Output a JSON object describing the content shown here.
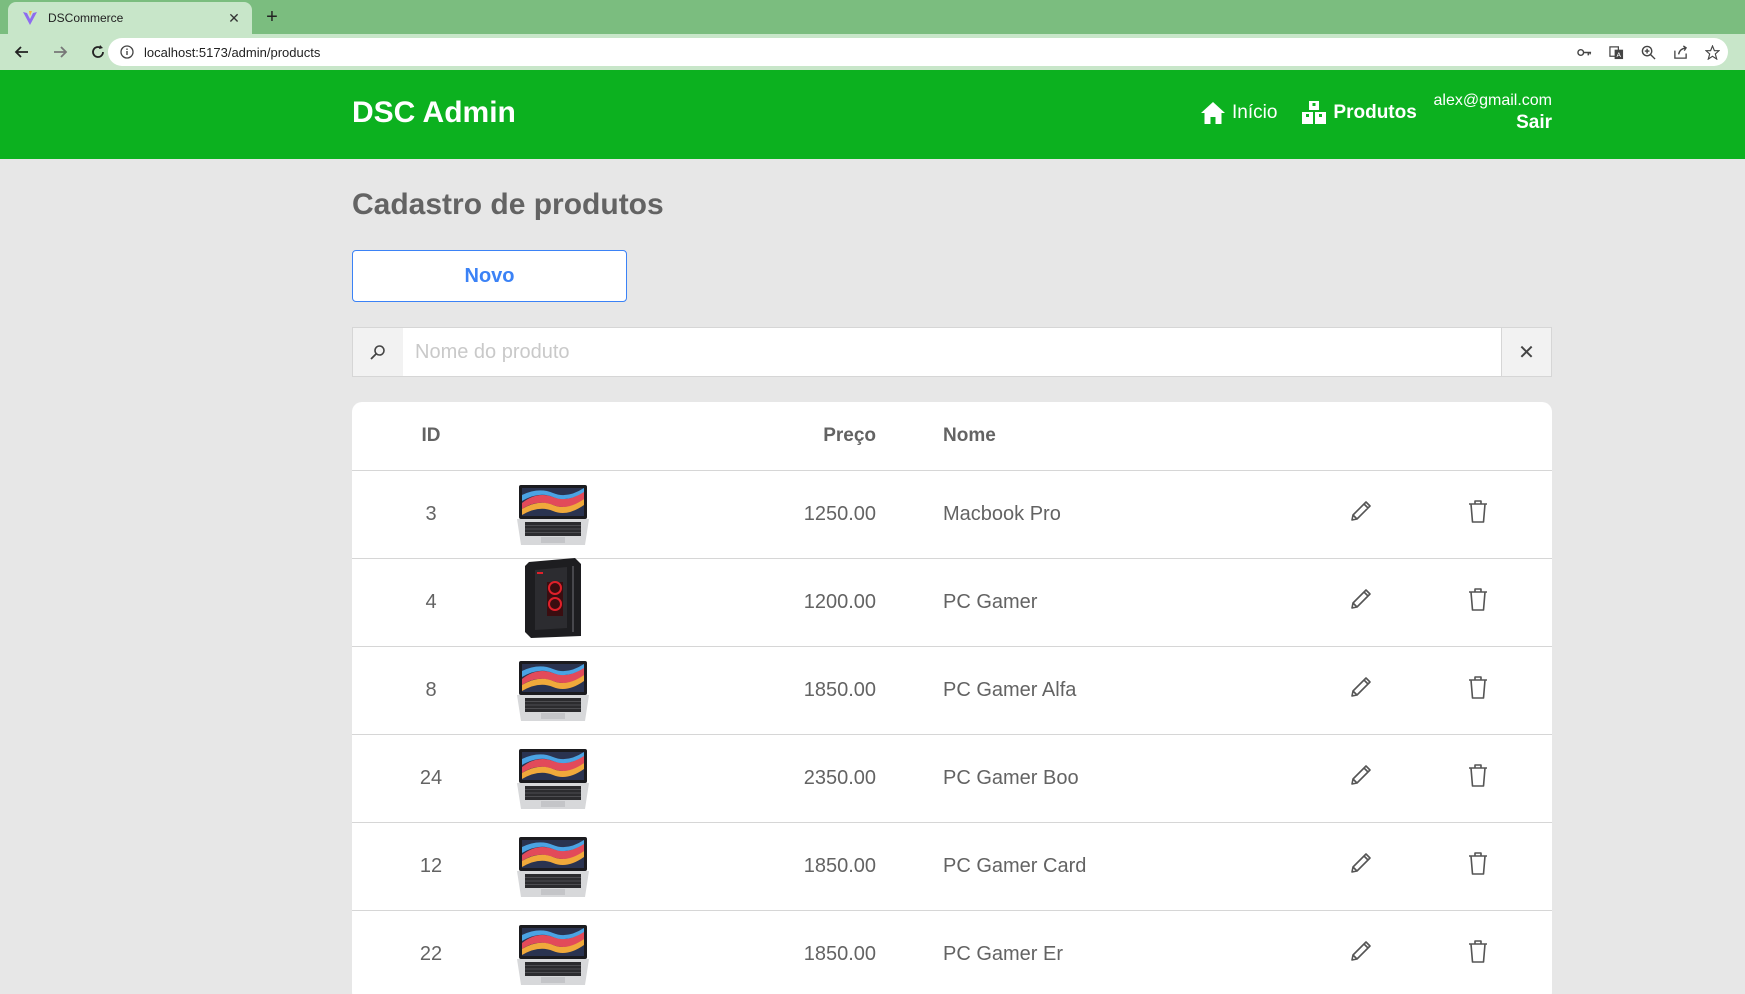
{
  "browser": {
    "tab_title": "DSCommerce",
    "url": "localhost:5173/admin/products"
  },
  "header": {
    "brand": "DSC Admin",
    "nav": [
      {
        "label": "Início",
        "icon": "home-icon",
        "active": false
      },
      {
        "label": "Produtos",
        "icon": "boxes-icon",
        "active": true
      }
    ],
    "user_email": "alex@gmail.com",
    "logout_label": "Sair",
    "color": "#0cb11f"
  },
  "page": {
    "title": "Cadastro de produtos",
    "new_button": "Novo",
    "search_placeholder": "Nome do produto"
  },
  "table": {
    "columns": [
      "ID",
      "",
      "Preço",
      "Nome",
      "",
      ""
    ],
    "rows": [
      {
        "id": "3",
        "image": "laptop",
        "price": "1250.00",
        "name": "Macbook Pro"
      },
      {
        "id": "4",
        "image": "pc-tower",
        "price": "1200.00",
        "name": "PC Gamer"
      },
      {
        "id": "8",
        "image": "laptop",
        "price": "1850.00",
        "name": "PC Gamer Alfa"
      },
      {
        "id": "24",
        "image": "laptop",
        "price": "2350.00",
        "name": "PC Gamer Boo"
      },
      {
        "id": "12",
        "image": "laptop",
        "price": "1850.00",
        "name": "PC Gamer Card"
      },
      {
        "id": "22",
        "image": "laptop",
        "price": "1850.00",
        "name": "PC Gamer Er"
      }
    ]
  }
}
